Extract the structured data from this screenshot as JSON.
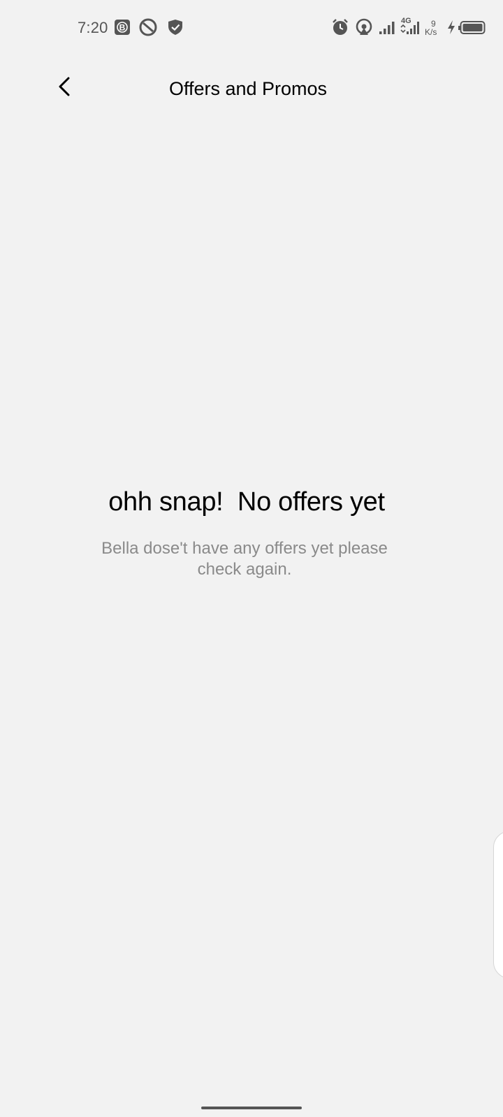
{
  "status_bar": {
    "time": "7:20",
    "network_type": "4G",
    "speed_value": "9",
    "speed_unit": "K/s",
    "icons": [
      "app-b-icon",
      "no-entry-icon",
      "shield-icon",
      "alarm-icon",
      "hotspot-icon",
      "signal-icon",
      "signal-4g-icon",
      "charging-bolt-icon",
      "battery-icon"
    ]
  },
  "header": {
    "title": "Offers and Promos",
    "back_icon": "chevron-left-icon"
  },
  "empty_state": {
    "title": "ohh snap!  No offers yet",
    "message": "Bella dose't have any offers yet please check again."
  },
  "colors": {
    "background": "#f2f2f2",
    "title_text": "#000000",
    "message_text": "#8a8a8a",
    "status_icons": "#555555"
  }
}
